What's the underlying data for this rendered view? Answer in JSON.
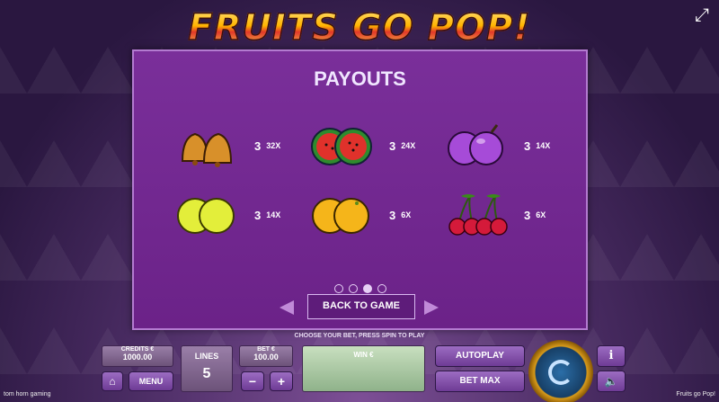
{
  "header": {
    "logo_text": "FRUITS GO POP!",
    "fullscreen_icon": "expand-icon"
  },
  "paytable": {
    "title": "PAYOUTS",
    "rows": [
      [
        {
          "symbol": "bell",
          "count": "3",
          "multiplier": "32X"
        },
        {
          "symbol": "watermelon",
          "count": "3",
          "multiplier": "24X"
        },
        {
          "symbol": "plum",
          "count": "3",
          "multiplier": "14X"
        }
      ],
      [
        {
          "symbol": "lemon",
          "count": "3",
          "multiplier": "14X"
        },
        {
          "symbol": "orange",
          "count": "3",
          "multiplier": "6X"
        },
        {
          "symbol": "cherry",
          "count": "3",
          "multiplier": "6X"
        }
      ]
    ],
    "pages": 4,
    "active_page": 3,
    "back_label": "BACK TO GAME"
  },
  "hint": "CHOOSE YOUR BET, PRESS SPIN TO PLAY",
  "controls": {
    "credits_label": "CREDITS €",
    "credits_value": "1000.00",
    "menu_label": "MENU",
    "lines_label": "LINES",
    "lines_value": "5",
    "bet_label": "BET €",
    "bet_value": "100.00",
    "win_label": "WIN €",
    "autoplay_label": "AUTOPLAY",
    "betmax_label": "BET MAX"
  },
  "footer": {
    "left": "tom horn gaming",
    "right": "Fruits go Pop!"
  },
  "colors": {
    "panel": "#6b2288",
    "accent_gold": "#d89b1a"
  }
}
